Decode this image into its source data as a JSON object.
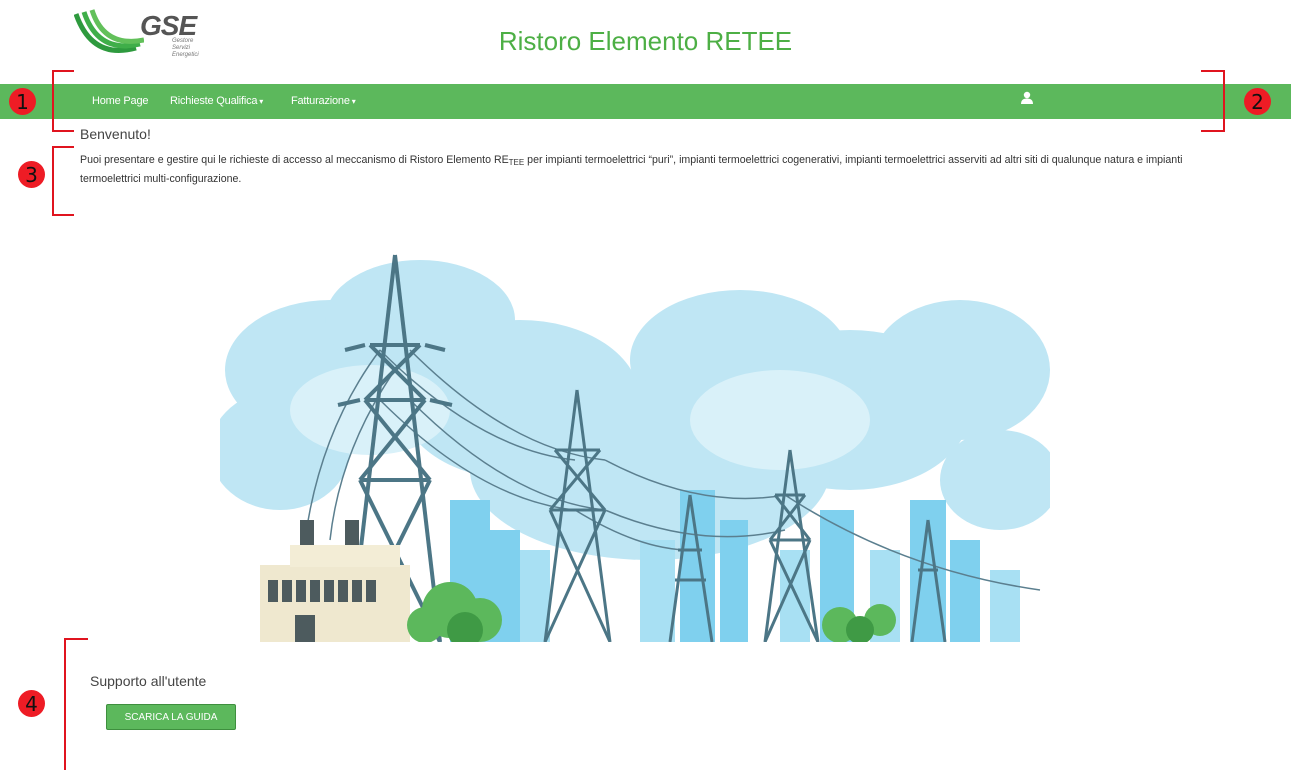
{
  "header": {
    "logo_text": "GSE",
    "logo_subtitle_lines": [
      "Gestore",
      "Servizi",
      "Energetici"
    ],
    "app_title": "Ristoro Elemento RETEE"
  },
  "nav": {
    "items": [
      {
        "label": "Home Page"
      },
      {
        "label": "Richieste Qualifica",
        "caret": "▾"
      },
      {
        "label": "Fatturazione",
        "caret": "▾"
      }
    ],
    "user_icon": "user-icon"
  },
  "markers": [
    "1",
    "2",
    "3",
    "4"
  ],
  "main": {
    "welcome": "Benvenuto!",
    "intro_part1": "Puoi presentare e gestire qui le richieste di accesso al meccanismo di Ristoro Elemento RE",
    "intro_sub": "TEE",
    "intro_part2": " per impianti termoelettrici “puri”, impianti termoelettrici cogenerativi, impianti termoelettrici asserviti ad altri siti di qualunque natura e impianti termoelettrici multi-configurazione."
  },
  "support": {
    "title": "Supporto all'utente",
    "button_label": "SCARICA LA GUIDA"
  },
  "colors": {
    "brand_green": "#5cb85c",
    "title_green": "#4daf45",
    "marker_red": "#ee1c25"
  }
}
